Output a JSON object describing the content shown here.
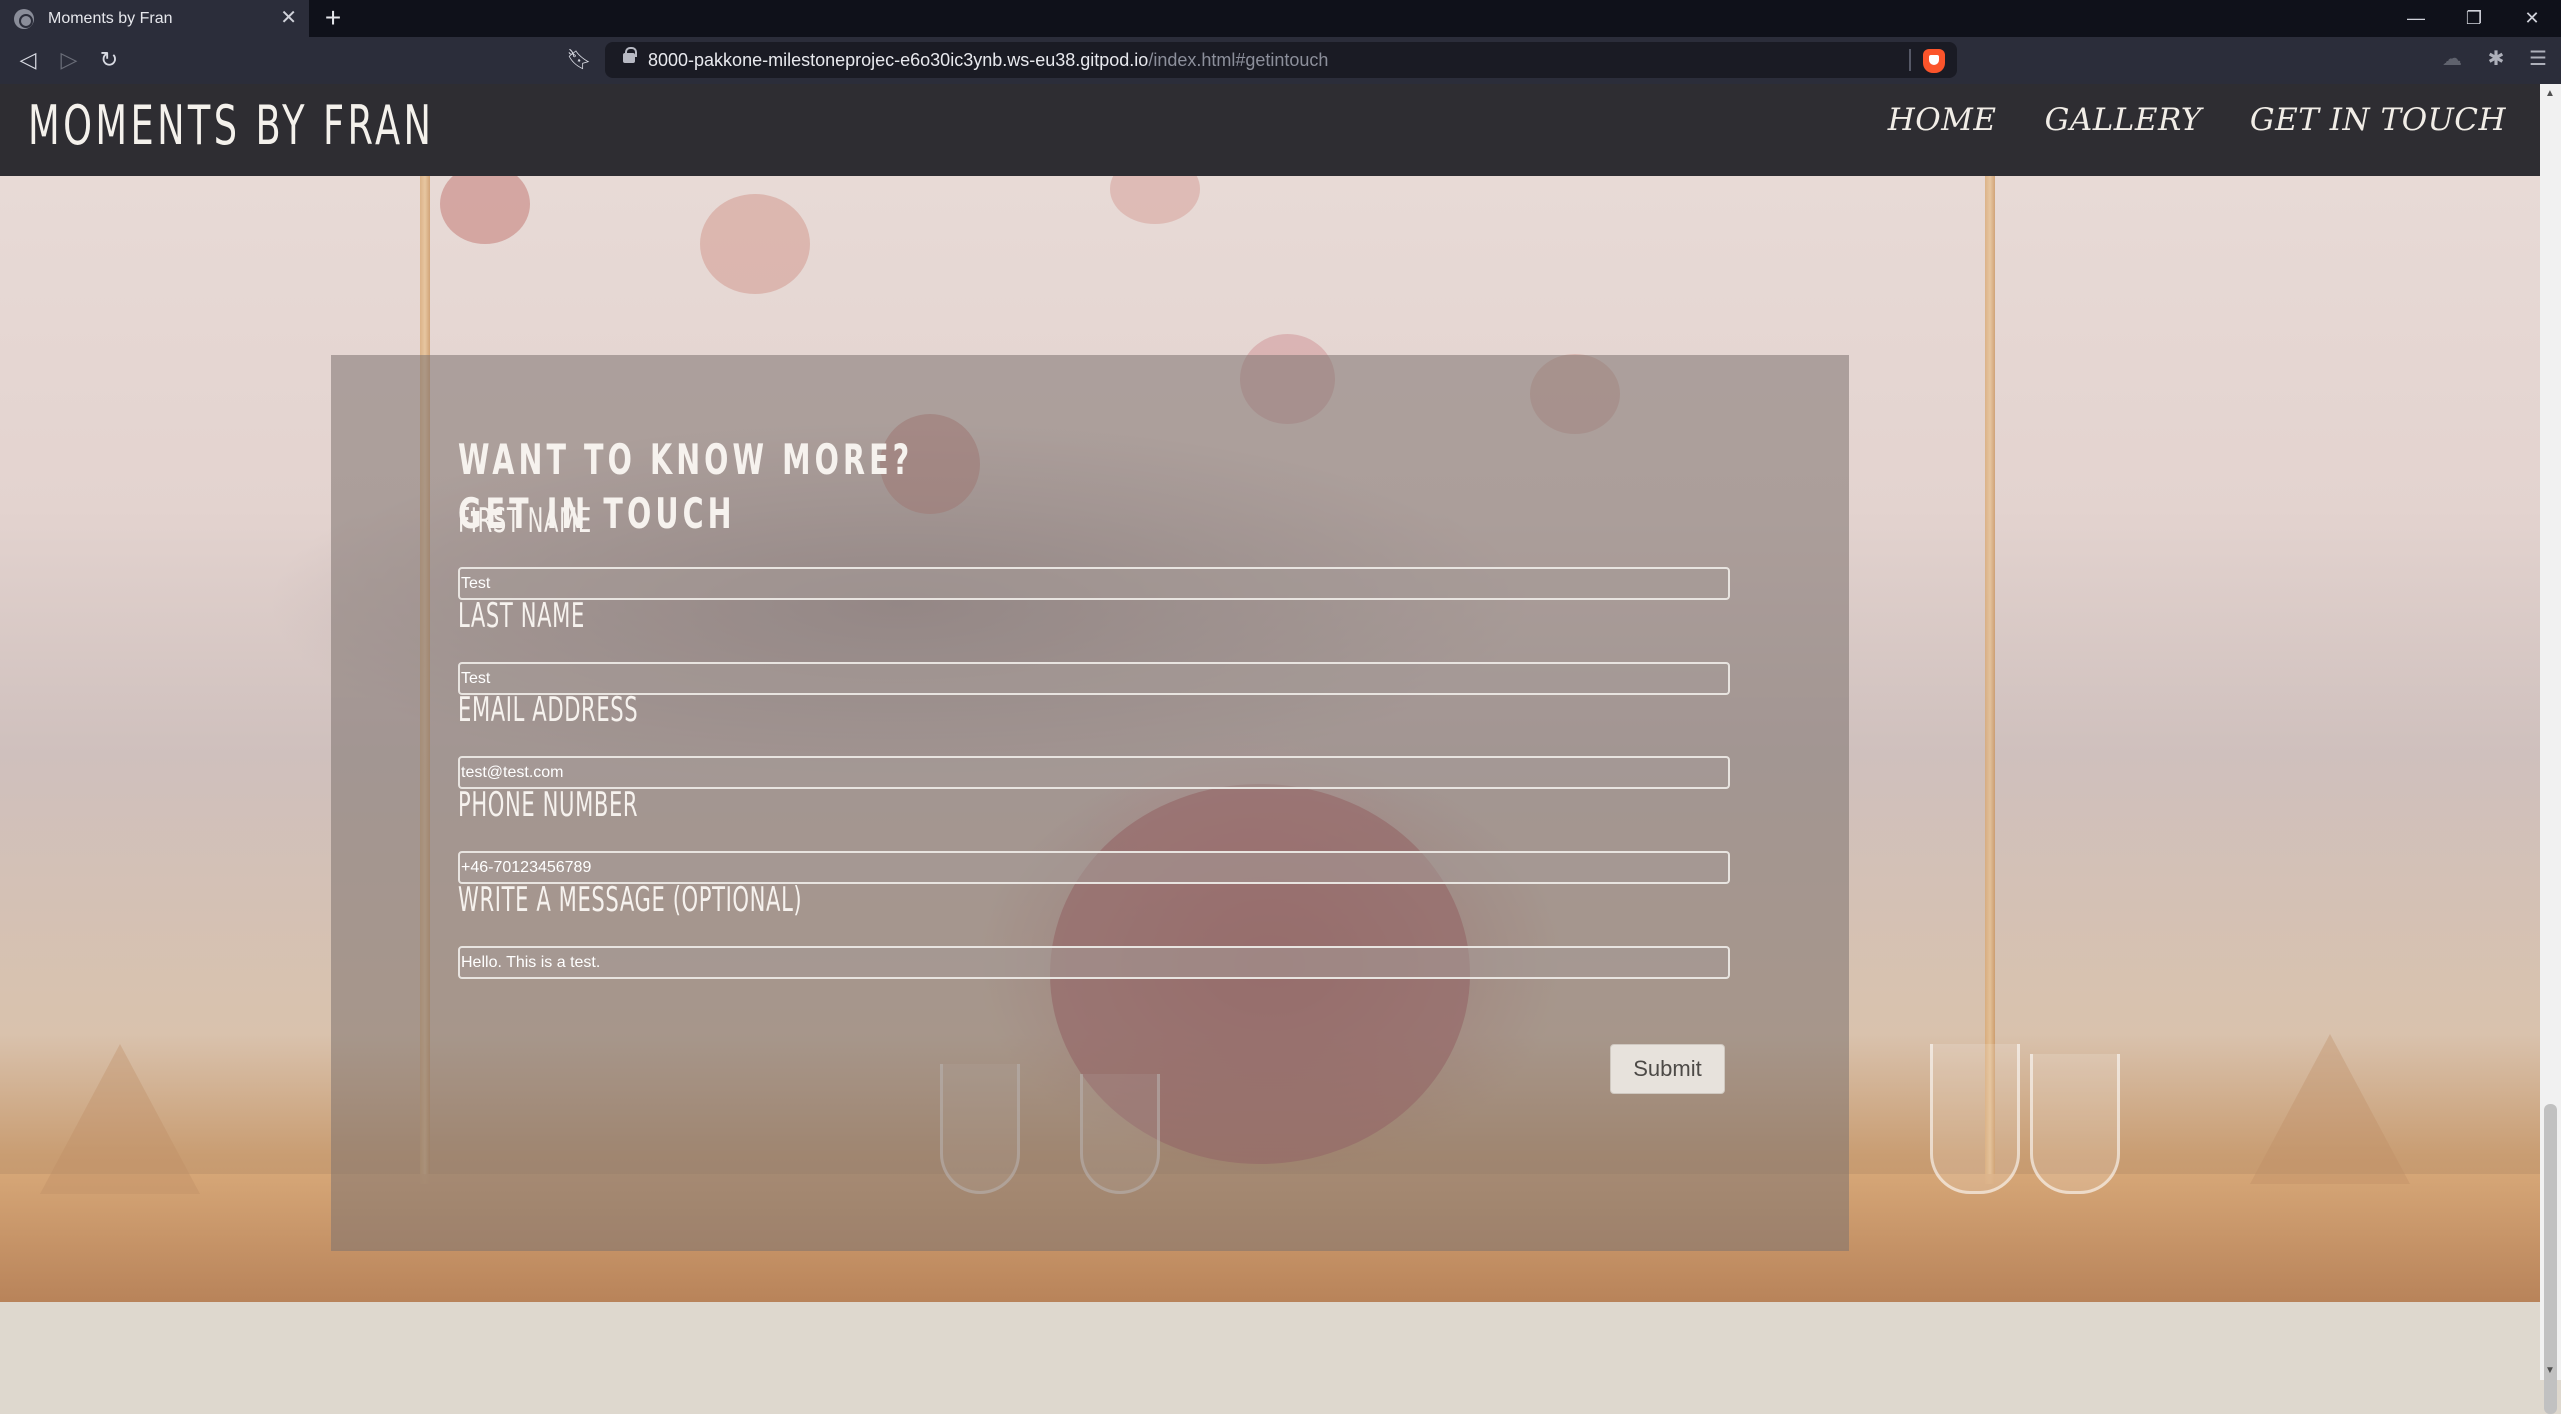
{
  "browser": {
    "tab_title": "Moments by Fran",
    "url_main": "8000-pakkone-milestoneprojec-e6o30ic3ynb.ws-eu38.gitpod.io",
    "url_path": "/index.html#getintouch"
  },
  "site": {
    "logo": "MOMENTS BY FRAN",
    "nav": {
      "home": "HOME",
      "gallery": "GALLERY",
      "get_in_touch": "GET IN TOUCH"
    }
  },
  "form": {
    "heading_line1": "WANT TO KNOW MORE?",
    "heading_line2": "GET IN TOUCH",
    "first_name_label": "FIRST NAME",
    "first_name_value": "Test",
    "last_name_label": "LAST NAME",
    "last_name_value": "Test",
    "email_label": "EMAIL ADDRESS",
    "email_value": "test@test.com",
    "phone_label": "PHONE NUMBER",
    "phone_value": "+46-70123456789",
    "message_label": "WRITE A MESSAGE (OPTIONAL)",
    "message_value": "Hello. This is a test.",
    "submit_label": "Submit"
  }
}
